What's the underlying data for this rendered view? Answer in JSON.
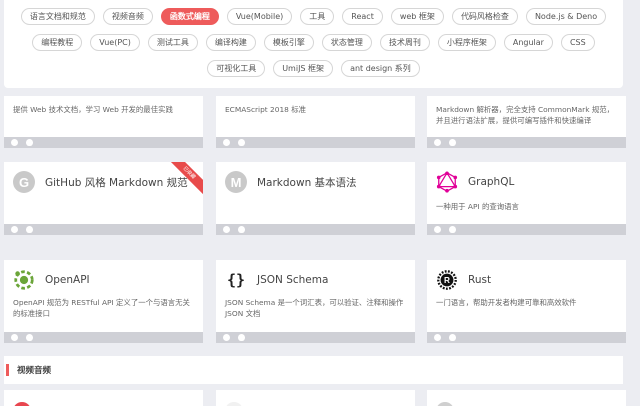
{
  "tags": {
    "row1": [
      "语言文档和规范",
      "视频音频",
      "函数式编程",
      "Vue(Mobile)",
      "工具",
      "React",
      "web 框架",
      "代码风格检查",
      "Node.js & Deno"
    ],
    "row2": [
      "编程教程",
      "Vue(PC)",
      "测试工具",
      "编译构建",
      "模板引擎",
      "状态管理",
      "技术周刊",
      "小程序框架",
      "Angular",
      "CSS"
    ],
    "row3": [
      "可视化工具",
      "UmiJS 框架",
      "ant design 系列"
    ],
    "active": "函数式编程"
  },
  "row_top": [
    {
      "desc": "提供 Web 技术文档，学习 Web 开发的最佳实践"
    },
    {
      "desc": "ECMAScript 2018 标准"
    },
    {
      "desc": "Markdown 解析器，完全支持 CommonMark 规范，并且进行语法扩展，提供可编写插件和快速编译"
    }
  ],
  "row_mid": [
    {
      "title": "GitHub 风格 Markdown 规范",
      "logo": "G",
      "ribbon": "已收藏",
      "desc": ""
    },
    {
      "title": "Markdown 基本语法",
      "logo": "M",
      "desc": ""
    },
    {
      "title": "GraphQL",
      "logo": "graphql-icon",
      "desc": "一种用于 API 的查询语言"
    }
  ],
  "row_bottom": [
    {
      "title": "OpenAPI",
      "logo": "openapi-icon",
      "desc": "OpenAPI 规范为 RESTful API 定义了一个与语言无关的标准接口"
    },
    {
      "title": "JSON Schema",
      "logo": "{}",
      "desc": "JSON Schema 是一个词汇表，可以验证、注释和操作 JSON 文档"
    },
    {
      "title": "Rust",
      "logo": "rust-icon",
      "desc": "一门语言，帮助开发者构建可靠和高效软件"
    }
  ],
  "section": {
    "title": "视频音频"
  },
  "colors": {
    "accent": "#ee5b5b",
    "graphql": "#e10098",
    "openapi": "#6ba539"
  }
}
